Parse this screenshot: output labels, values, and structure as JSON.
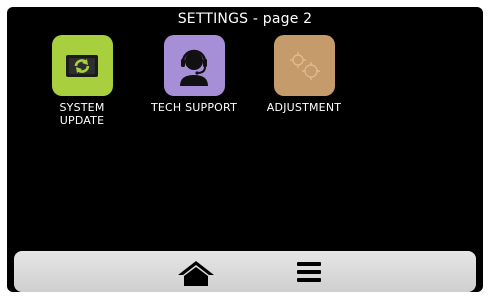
{
  "header": {
    "title": "SETTINGS - page 2"
  },
  "tiles": [
    {
      "label_line1": "SYSTEM",
      "label_line2": "UPDATE",
      "icon": "system-update-icon",
      "color": "#a8cf3d"
    },
    {
      "label_line1": "TECH SUPPORT",
      "label_line2": "",
      "icon": "headset-icon",
      "color": "#a78fd8"
    },
    {
      "label_line1": "ADJUSTMENT",
      "label_line2": "",
      "icon": "adjustment-icon",
      "color": "#c69b6b"
    }
  ],
  "nav": {
    "home_icon": "home-icon",
    "menu_icon": "menu-icon"
  }
}
